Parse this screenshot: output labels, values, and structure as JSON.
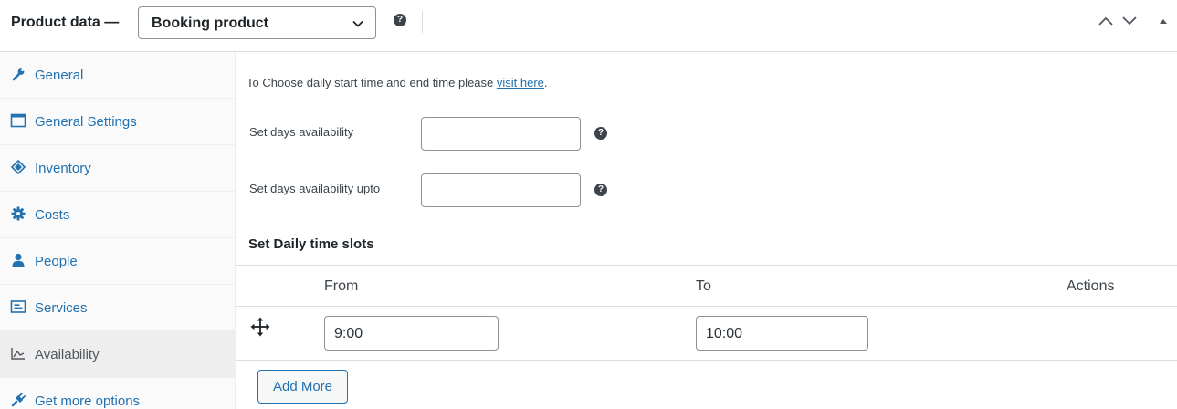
{
  "header": {
    "title": "Product data —",
    "product_type": "Booking product",
    "help_glyph": "?"
  },
  "sidebar": {
    "items": [
      {
        "label": "General",
        "icon": "wrench-icon"
      },
      {
        "label": "General Settings",
        "icon": "window-icon"
      },
      {
        "label": "Inventory",
        "icon": "tag-icon"
      },
      {
        "label": "Costs",
        "icon": "gear-icon"
      },
      {
        "label": "People",
        "icon": "person-icon"
      },
      {
        "label": "Services",
        "icon": "list-box-icon"
      },
      {
        "label": "Availability",
        "icon": "chart-area-icon",
        "active": true
      },
      {
        "label": "Get more options",
        "icon": "plugin-icon"
      }
    ]
  },
  "main": {
    "notice_text": "To Choose daily start time and end time please ",
    "notice_link": "visit here",
    "notice_suffix": ".",
    "fields": [
      {
        "label": "Set days availability",
        "value": ""
      },
      {
        "label": "Set days availability upto",
        "value": ""
      }
    ],
    "section_title": "Set Daily time slots",
    "table": {
      "headers": [
        "From",
        "To",
        "Actions"
      ],
      "rows": [
        {
          "from": "9:00",
          "to": "10:00"
        }
      ]
    },
    "add_more_label": "Add More"
  },
  "colors": {
    "link": "#2271b1",
    "text": "#1d2327",
    "border": "#8c8f94",
    "active_bg": "#eeeeee"
  }
}
